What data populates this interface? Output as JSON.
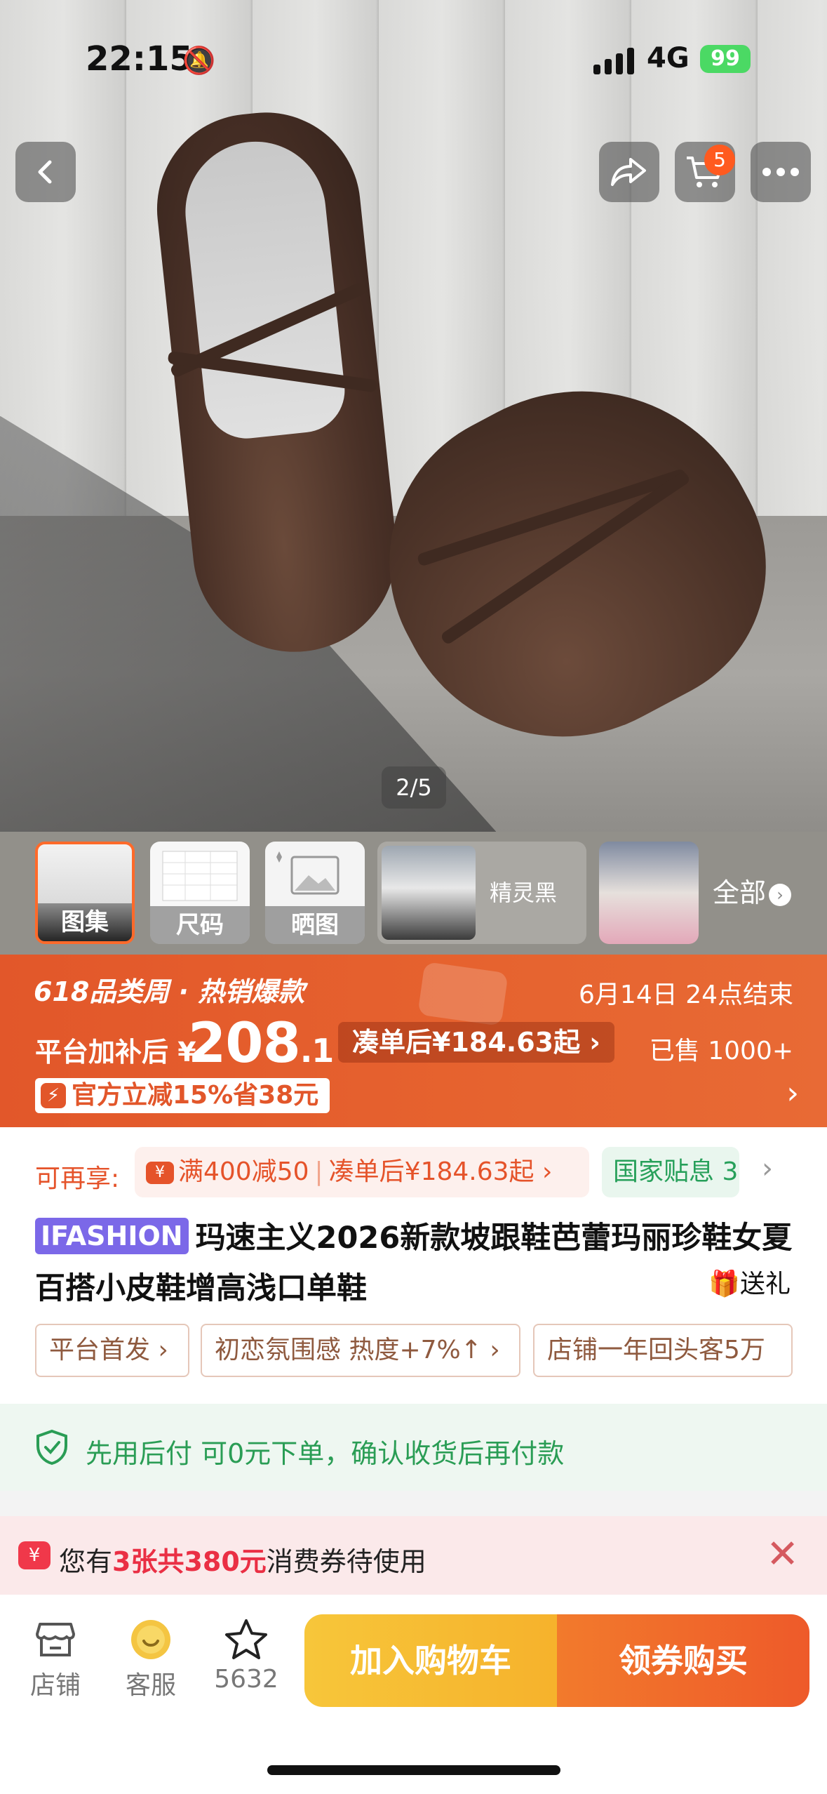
{
  "status_bar": {
    "time": "22:15",
    "network": "4G",
    "battery": "99"
  },
  "header": {
    "cart_badge": "5"
  },
  "gallery": {
    "pager": "2/5"
  },
  "thumbnails": {
    "items": [
      {
        "label": "图集"
      },
      {
        "label": "尺码"
      },
      {
        "label": "晒图"
      }
    ],
    "variant_label": "精灵黑",
    "all_label": "全部"
  },
  "promo": {
    "event": "618品类周 · 热销爆款",
    "ends": "6月14日 24点结束",
    "price_label": "平台加补后 ¥",
    "price_int": "208",
    "price_dec": ".1",
    "combo": "凑单后¥184.63起 ›",
    "sold": "已售 1000+",
    "coupon": "官方立减15%省38元"
  },
  "extras": {
    "label": "可再享:",
    "deal1": "满400减50",
    "deal2": "凑单后¥184.63起 ›",
    "subsidy": "国家贴息 3"
  },
  "product": {
    "brand": "IFASHION",
    "title": "玛速主义2026新款坡跟鞋芭蕾玛丽珍鞋女夏百搭小皮鞋增高浅口单鞋",
    "gift": "送礼"
  },
  "tags": [
    "平台首发 ›",
    "初恋氛围感 热度+7%↑ ›",
    "店铺一年回头客5万"
  ],
  "pay_later": {
    "text": "先用后付 可0元下单，确认收货后再付款"
  },
  "coupon_notice": {
    "prefix": "您有",
    "highlight": "3张共380元",
    "suffix": "消费券待使用"
  },
  "bottom_bar": {
    "store": "店铺",
    "service": "客服",
    "favorites": "5632",
    "add_to_cart": "加入购物车",
    "buy": "领券购买"
  },
  "colors": {
    "accent": "#e5532a",
    "cart_btn": "#f7c63a",
    "buy_btn": "#ee5a2a",
    "green": "#2a9d55"
  }
}
